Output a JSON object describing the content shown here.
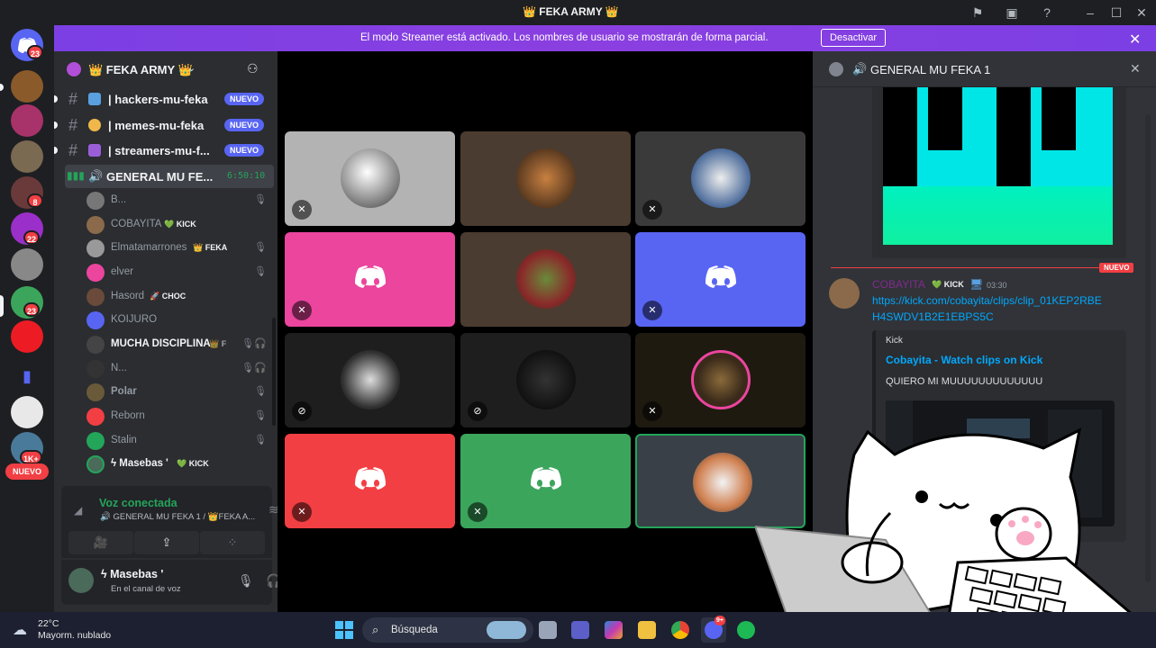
{
  "window": {
    "title": "👑 FEKA ARMY 👑"
  },
  "banner": {
    "text": "El modo Streamer está activado. Los nombres de usuario se mostrarán de forma parcial.",
    "button": "Desactivar"
  },
  "rail": {
    "badges": [
      "23",
      "8",
      "22",
      "23",
      "1K+"
    ],
    "new_label": "NUEVO"
  },
  "server": {
    "name": "👑 FEKA ARMY 👑"
  },
  "channels": [
    {
      "name": "| hackers-mu-feka",
      "badge": "NUEVO"
    },
    {
      "name": "| memes-mu-feka",
      "badge": "NUEVO"
    },
    {
      "name": "| streamers-mu-f...",
      "badge": "NUEVO"
    }
  ],
  "voice_channel": {
    "name": "GENERAL MU FE...",
    "timer": "6:50:10"
  },
  "members": [
    {
      "name": "B...",
      "tag": ""
    },
    {
      "name": "COBAYITA",
      "tag": "💚 KICK"
    },
    {
      "name": "Elmatamarrones",
      "tag": "👑 FEKA"
    },
    {
      "name": "elver",
      "tag": ""
    },
    {
      "name": "Hasord",
      "tag": "🚀 CHOC"
    },
    {
      "name": "KOIJURO",
      "tag": ""
    },
    {
      "name": "MUCHA DISCIPLINA",
      "tag": "👑 F"
    },
    {
      "name": "N...",
      "tag": ""
    },
    {
      "name": "Polar",
      "tag": ""
    },
    {
      "name": "Reborn",
      "tag": ""
    },
    {
      "name": "Stalin",
      "tag": ""
    },
    {
      "name": "ϟ Masebas '",
      "tag": "💚 KICK"
    }
  ],
  "voice_status": {
    "title": "Voz conectada",
    "location": "🔊 GENERAL MU FEKA 1 / 👑FEKA A..."
  },
  "user": {
    "name": "ϟ Masebas '",
    "status": "En el canal de voz"
  },
  "chat": {
    "header": "GENERAL MU FEKA 1",
    "new_divider": "NUEVO",
    "author": "COBAYITA",
    "author_tag": "💚 KICK",
    "time": "03:30",
    "link": "https://kick.com/cobayita/clips/clip_01KEP2RBEH4SWDV1B2E1EBPS5C",
    "link_line1": "https://kick.com/cobayita/clips/clip_01KEP2RBE",
    "link_line2": "H4SWDV1B2E1EBPS5C",
    "embed_provider": "Kick",
    "embed_title": "Cobayita - Watch clips on Kick",
    "embed_desc": "QUIERO MI MUUUUUUUUUUUUU"
  },
  "taskbar": {
    "temp": "22°C",
    "weather": "Mayorm. nublado",
    "search": "Búsqueda",
    "discord_badge": "9+"
  },
  "colors": {
    "blurple": "#5865f2",
    "banner": "#7b3fe4",
    "red": "#f23f43",
    "green": "#23a55a",
    "pink": "#eb459e",
    "link": "#00a8fc"
  }
}
